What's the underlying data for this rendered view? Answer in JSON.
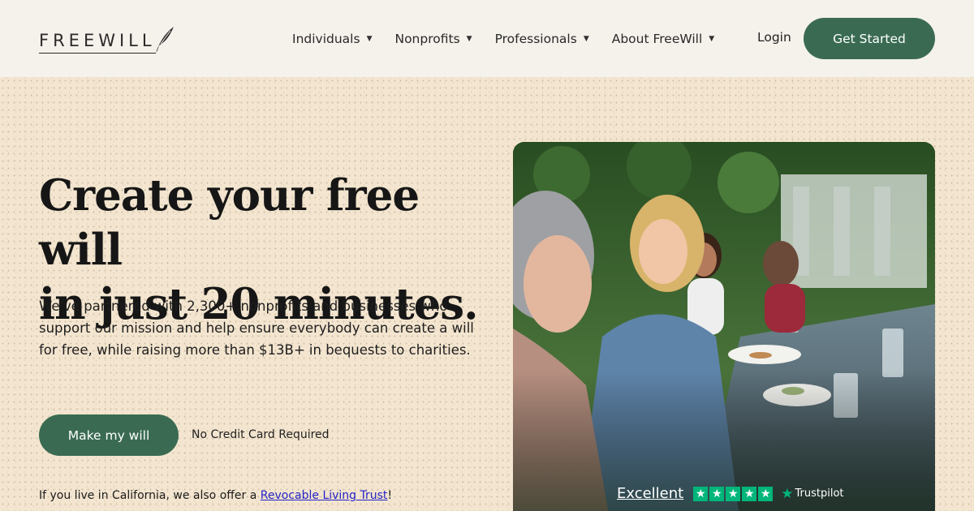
{
  "header": {
    "logo_text": "FREEWILL",
    "nav": [
      {
        "label": "Individuals"
      },
      {
        "label": "Nonprofits"
      },
      {
        "label": "Professionals"
      },
      {
        "label": "About FreeWill"
      }
    ],
    "login_label": "Login",
    "cta_label": "Get Started"
  },
  "hero": {
    "title_line1": "Create your free will",
    "title_line2": "in just 20 minutes.",
    "lead": "We've partnered with 2,300+ nonprofits and businesses who support our mission and help ensure everybody can create a will for free, while raising more than $13B+ in bequests to charities.",
    "button_label": "Make my will",
    "no_credit_card": "No Credit Card Required",
    "ca_prefix": "If you live in California, we also offer a ",
    "ca_link": "Revocable Living Trust",
    "ca_suffix": "!"
  },
  "trustpilot": {
    "rating_label": "Excellent",
    "stars": 5,
    "brand": "Trustpilot",
    "color": "#00b67a"
  },
  "colors": {
    "brand_green": "#3a6b52",
    "hero_bg": "#f3e5cf",
    "header_bg": "#f5f1eb"
  }
}
